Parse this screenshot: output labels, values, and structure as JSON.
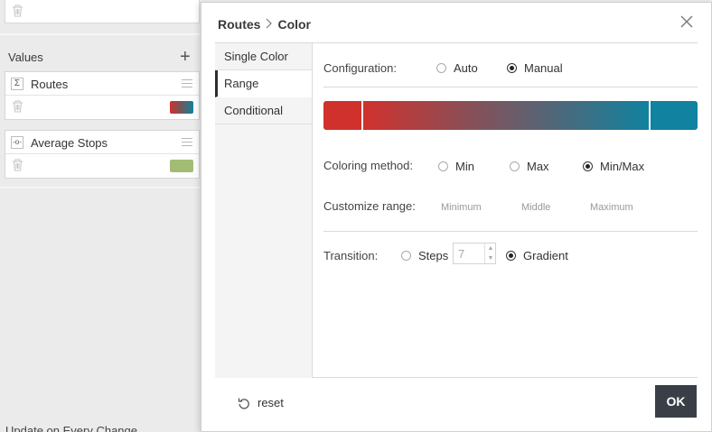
{
  "background": {
    "values_title": "Values",
    "fields": [
      {
        "name": "Routes",
        "icon": "sigma-icon",
        "icon_glyph": "Σ",
        "swatch": "gradient"
      },
      {
        "name": "Average Stops",
        "icon": "line-chart-icon",
        "icon_glyph": "-o-",
        "swatch": "#a2bd73"
      }
    ],
    "update_text": "Update on Every Change"
  },
  "dialog": {
    "breadcrumb_parent": "Routes",
    "breadcrumb_sep": "〉",
    "breadcrumb_current": "Color",
    "tabs": [
      {
        "label": "Single Color",
        "active": false
      },
      {
        "label": "Range",
        "active": true
      },
      {
        "label": "Conditional",
        "active": false
      }
    ],
    "configuration": {
      "label": "Configuration:",
      "options": [
        "Auto",
        "Manual"
      ],
      "selected": "Manual"
    },
    "gradient": {
      "min_color": "#d0312d",
      "max_color": "#11829f"
    },
    "coloring_method": {
      "label": "Coloring method:",
      "options": [
        "Min",
        "Max",
        "Min/Max"
      ],
      "selected": "Min/Max"
    },
    "customize_range": {
      "label": "Customize range:",
      "minimum_placeholder": "Minimum",
      "middle_placeholder": "Middle",
      "maximum_placeholder": "Maximum"
    },
    "transition": {
      "label": "Transition:",
      "steps_label": "Steps",
      "steps_value": "7",
      "gradient_label": "Gradient",
      "selected": "Gradient"
    },
    "reset_label": "reset",
    "ok_label": "OK"
  }
}
